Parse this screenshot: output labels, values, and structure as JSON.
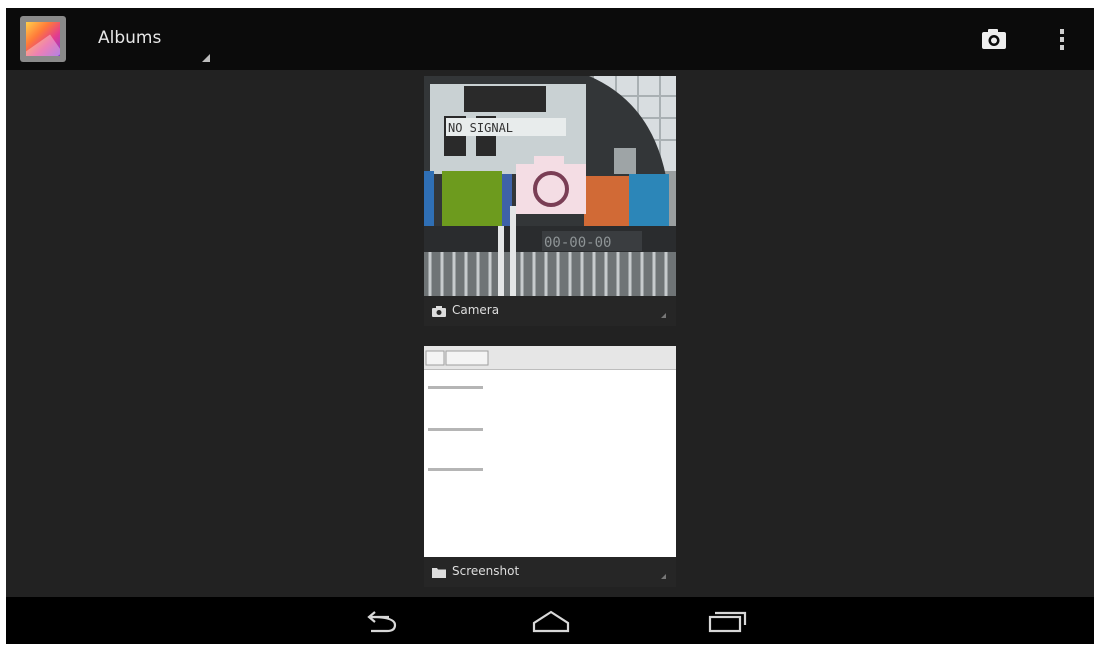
{
  "action_bar": {
    "app_icon": "gallery-icon",
    "spinner_label": "Albums",
    "camera_icon": "camera-icon",
    "overflow_icon": "overflow-menu-icon"
  },
  "albums": [
    {
      "label": "Camera",
      "icon": "camera-icon",
      "thumbnail_text": "NO SIGNAL"
    },
    {
      "label": "Screenshot",
      "icon": "folder-icon"
    }
  ],
  "nav_bar": {
    "back_icon": "back-icon",
    "home_icon": "home-icon",
    "recents_icon": "recent-apps-icon"
  },
  "colors": {
    "background": "#222222",
    "action_bar": "#0b0b0b",
    "nav_bar": "#000000",
    "caption_bg": "#282828"
  }
}
